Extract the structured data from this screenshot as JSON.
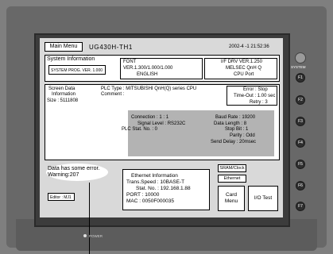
{
  "header": {
    "main_menu": "Main Menu",
    "model": "UG430H-TH1",
    "datetime": "2002-4 -1 21:52:36"
  },
  "system_information": {
    "title": "System Information",
    "prog_version": "SYSTEM PROG. VER. 1.000",
    "font_title": "FONT",
    "font_version": "VER.1.300/1.000/1.000",
    "font_language": "ENGLISH",
    "if_drv": "I/F DRV VER.1.250",
    "plc_name": "MELSEC QnH Q",
    "cpu_port": "CPU Port"
  },
  "screen_data": {
    "title_line1": "Screen Data",
    "title_line2": "Information",
    "size": "Size : 5111808",
    "plc_type": "PLC Type : MITSUBISHI QnH(Q) series CPU",
    "comment": "Comment :",
    "error": "Error : Stop",
    "timeout": "Time-Out : 1.00 sec",
    "retry": "Retry : 3"
  },
  "connection": {
    "connection": "Connection : 1 : 1",
    "signal_level": "Signal Level : RS232C",
    "plc_stat": "PLC Stat. No. : 0",
    "baud_rate": "Baud Rate : 19200",
    "data_length": "Data Length : 8",
    "stop_bit": "Stop Bit : 1",
    "parity": "Parity : Odd",
    "send_delay": "Send Delay : 20msec"
  },
  "warning": {
    "line1": "Data has some error.",
    "line2": "Warning:207"
  },
  "editor": "Editor : MJ1",
  "ethernet": {
    "title": "Ethernet Information",
    "trans_speed": "Trans.Speed : 10BASE-T",
    "stat_no": "Stat. No. : 192.168.1.88",
    "port": "PORT : 10000",
    "mac": "MAC : 0050F000035"
  },
  "buttons": {
    "sram_clock": "SRAM/Clock",
    "ethernet": "Ethernet",
    "card_menu_line1": "Card",
    "card_menu_line2": "Menu",
    "io_test": "I/O Test"
  },
  "side_keys": {
    "system": "SYSTEM",
    "f1": "F1",
    "f2": "F2",
    "f3": "F3",
    "f4": "F4",
    "f5": "F5",
    "f6": "F6",
    "f7": "F7"
  },
  "power_label": "POWER"
}
